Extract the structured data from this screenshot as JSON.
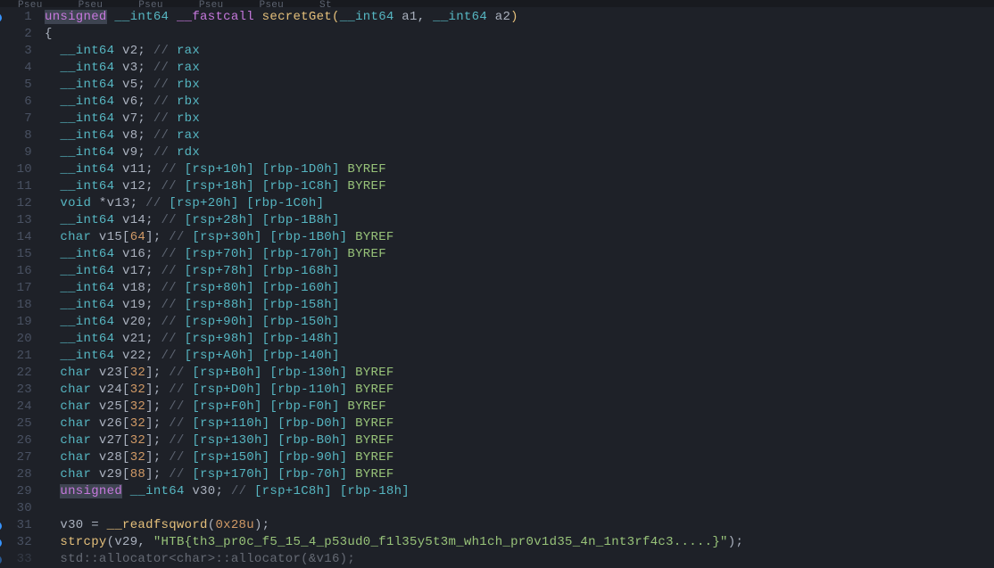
{
  "tabs": [
    "Pseu",
    "Pseu",
    "Pseu",
    "Pseu",
    "Pseu",
    "St"
  ],
  "lines": [
    {
      "n": 1,
      "bp": true,
      "tokens": [
        {
          "c": "kw-mod hl-bg",
          "t": "unsigned"
        },
        {
          "c": "op",
          "t": " "
        },
        {
          "c": "kw-type",
          "t": "__int64"
        },
        {
          "c": "op",
          "t": " "
        },
        {
          "c": "kw-mod",
          "t": "__fastcall"
        },
        {
          "c": "op",
          "t": " "
        },
        {
          "c": "kw-func",
          "t": "secretGet"
        },
        {
          "c": "paren-open",
          "t": "("
        },
        {
          "c": "kw-type",
          "t": "__int64"
        },
        {
          "c": "op",
          "t": " a1, "
        },
        {
          "c": "kw-type",
          "t": "__int64"
        },
        {
          "c": "op",
          "t": " a2"
        },
        {
          "c": "paren-close",
          "t": ")"
        }
      ]
    },
    {
      "n": 2,
      "bp": false,
      "tokens": [
        {
          "c": "brace",
          "t": "{"
        }
      ]
    },
    {
      "n": 3,
      "bp": false,
      "tokens": [
        {
          "c": "op",
          "t": "  "
        },
        {
          "c": "kw-type",
          "t": "__int64"
        },
        {
          "c": "op",
          "t": " v2; "
        },
        {
          "c": "comment",
          "t": "// "
        },
        {
          "c": "comment-str",
          "t": "rax"
        }
      ]
    },
    {
      "n": 4,
      "bp": false,
      "tokens": [
        {
          "c": "op",
          "t": "  "
        },
        {
          "c": "kw-type",
          "t": "__int64"
        },
        {
          "c": "op",
          "t": " v3; "
        },
        {
          "c": "comment",
          "t": "// "
        },
        {
          "c": "comment-str",
          "t": "rax"
        }
      ]
    },
    {
      "n": 5,
      "bp": false,
      "tokens": [
        {
          "c": "op",
          "t": "  "
        },
        {
          "c": "kw-type",
          "t": "__int64"
        },
        {
          "c": "op",
          "t": " v5; "
        },
        {
          "c": "comment",
          "t": "// "
        },
        {
          "c": "comment-str",
          "t": "rbx"
        }
      ]
    },
    {
      "n": 6,
      "bp": false,
      "tokens": [
        {
          "c": "op",
          "t": "  "
        },
        {
          "c": "kw-type",
          "t": "__int64"
        },
        {
          "c": "op",
          "t": " v6; "
        },
        {
          "c": "comment",
          "t": "// "
        },
        {
          "c": "comment-str",
          "t": "rbx"
        }
      ]
    },
    {
      "n": 7,
      "bp": false,
      "tokens": [
        {
          "c": "op",
          "t": "  "
        },
        {
          "c": "kw-type",
          "t": "__int64"
        },
        {
          "c": "op",
          "t": " v7; "
        },
        {
          "c": "comment",
          "t": "// "
        },
        {
          "c": "comment-str",
          "t": "rbx"
        }
      ]
    },
    {
      "n": 8,
      "bp": false,
      "tokens": [
        {
          "c": "op",
          "t": "  "
        },
        {
          "c": "kw-type",
          "t": "__int64"
        },
        {
          "c": "op",
          "t": " v8; "
        },
        {
          "c": "comment",
          "t": "// "
        },
        {
          "c": "comment-str",
          "t": "rax"
        }
      ]
    },
    {
      "n": 9,
      "bp": false,
      "tokens": [
        {
          "c": "op",
          "t": "  "
        },
        {
          "c": "kw-type",
          "t": "__int64"
        },
        {
          "c": "op",
          "t": " v9; "
        },
        {
          "c": "comment",
          "t": "// "
        },
        {
          "c": "comment-str",
          "t": "rdx"
        }
      ]
    },
    {
      "n": 10,
      "bp": false,
      "tokens": [
        {
          "c": "op",
          "t": "  "
        },
        {
          "c": "kw-type",
          "t": "__int64"
        },
        {
          "c": "op",
          "t": " v11; "
        },
        {
          "c": "comment",
          "t": "// "
        },
        {
          "c": "comment-str",
          "t": "[rsp+10h] [rbp-1D0h]"
        },
        {
          "c": "op",
          "t": " "
        },
        {
          "c": "comment-kw",
          "t": "BYREF"
        }
      ]
    },
    {
      "n": 11,
      "bp": false,
      "tokens": [
        {
          "c": "op",
          "t": "  "
        },
        {
          "c": "kw-type",
          "t": "__int64"
        },
        {
          "c": "op",
          "t": " v12; "
        },
        {
          "c": "comment",
          "t": "// "
        },
        {
          "c": "comment-str",
          "t": "[rsp+18h] [rbp-1C8h]"
        },
        {
          "c": "op",
          "t": " "
        },
        {
          "c": "comment-kw",
          "t": "BYREF"
        }
      ]
    },
    {
      "n": 12,
      "bp": false,
      "tokens": [
        {
          "c": "op",
          "t": "  "
        },
        {
          "c": "kw-type",
          "t": "void"
        },
        {
          "c": "op",
          "t": " *v13; "
        },
        {
          "c": "comment",
          "t": "// "
        },
        {
          "c": "comment-str",
          "t": "[rsp+20h] [rbp-1C0h]"
        }
      ]
    },
    {
      "n": 13,
      "bp": false,
      "tokens": [
        {
          "c": "op",
          "t": "  "
        },
        {
          "c": "kw-type",
          "t": "__int64"
        },
        {
          "c": "op",
          "t": " v14; "
        },
        {
          "c": "comment",
          "t": "// "
        },
        {
          "c": "comment-str",
          "t": "[rsp+28h] [rbp-1B8h]"
        }
      ]
    },
    {
      "n": 14,
      "bp": false,
      "tokens": [
        {
          "c": "op",
          "t": "  "
        },
        {
          "c": "kw-type",
          "t": "char"
        },
        {
          "c": "op",
          "t": " v15["
        },
        {
          "c": "num",
          "t": "64"
        },
        {
          "c": "op",
          "t": "]; "
        },
        {
          "c": "comment",
          "t": "// "
        },
        {
          "c": "comment-str",
          "t": "[rsp+30h] [rbp-1B0h]"
        },
        {
          "c": "op",
          "t": " "
        },
        {
          "c": "comment-kw",
          "t": "BYREF"
        }
      ]
    },
    {
      "n": 15,
      "bp": false,
      "tokens": [
        {
          "c": "op",
          "t": "  "
        },
        {
          "c": "kw-type",
          "t": "__int64"
        },
        {
          "c": "op",
          "t": " v16; "
        },
        {
          "c": "comment",
          "t": "// "
        },
        {
          "c": "comment-str",
          "t": "[rsp+70h] [rbp-170h]"
        },
        {
          "c": "op",
          "t": " "
        },
        {
          "c": "comment-kw",
          "t": "BYREF"
        }
      ]
    },
    {
      "n": 16,
      "bp": false,
      "tokens": [
        {
          "c": "op",
          "t": "  "
        },
        {
          "c": "kw-type",
          "t": "__int64"
        },
        {
          "c": "op",
          "t": " v17; "
        },
        {
          "c": "comment",
          "t": "// "
        },
        {
          "c": "comment-str",
          "t": "[rsp+78h] [rbp-168h]"
        }
      ]
    },
    {
      "n": 17,
      "bp": false,
      "tokens": [
        {
          "c": "op",
          "t": "  "
        },
        {
          "c": "kw-type",
          "t": "__int64"
        },
        {
          "c": "op",
          "t": " v18; "
        },
        {
          "c": "comment",
          "t": "// "
        },
        {
          "c": "comment-str",
          "t": "[rsp+80h] [rbp-160h]"
        }
      ]
    },
    {
      "n": 18,
      "bp": false,
      "tokens": [
        {
          "c": "op",
          "t": "  "
        },
        {
          "c": "kw-type",
          "t": "__int64"
        },
        {
          "c": "op",
          "t": " v19; "
        },
        {
          "c": "comment",
          "t": "// "
        },
        {
          "c": "comment-str",
          "t": "[rsp+88h] [rbp-158h]"
        }
      ]
    },
    {
      "n": 19,
      "bp": false,
      "tokens": [
        {
          "c": "op",
          "t": "  "
        },
        {
          "c": "kw-type",
          "t": "__int64"
        },
        {
          "c": "op",
          "t": " v20; "
        },
        {
          "c": "comment",
          "t": "// "
        },
        {
          "c": "comment-str",
          "t": "[rsp+90h] [rbp-150h]"
        }
      ]
    },
    {
      "n": 20,
      "bp": false,
      "tokens": [
        {
          "c": "op",
          "t": "  "
        },
        {
          "c": "kw-type",
          "t": "__int64"
        },
        {
          "c": "op",
          "t": " v21; "
        },
        {
          "c": "comment",
          "t": "// "
        },
        {
          "c": "comment-str",
          "t": "[rsp+98h] [rbp-148h]"
        }
      ]
    },
    {
      "n": 21,
      "bp": false,
      "tokens": [
        {
          "c": "op",
          "t": "  "
        },
        {
          "c": "kw-type",
          "t": "__int64"
        },
        {
          "c": "op",
          "t": " v22; "
        },
        {
          "c": "comment",
          "t": "// "
        },
        {
          "c": "comment-str",
          "t": "[rsp+A0h] [rbp-140h]"
        }
      ]
    },
    {
      "n": 22,
      "bp": false,
      "tokens": [
        {
          "c": "op",
          "t": "  "
        },
        {
          "c": "kw-type",
          "t": "char"
        },
        {
          "c": "op",
          "t": " v23["
        },
        {
          "c": "num",
          "t": "32"
        },
        {
          "c": "op",
          "t": "]; "
        },
        {
          "c": "comment",
          "t": "// "
        },
        {
          "c": "comment-str",
          "t": "[rsp+B0h] [rbp-130h]"
        },
        {
          "c": "op",
          "t": " "
        },
        {
          "c": "comment-kw",
          "t": "BYREF"
        }
      ]
    },
    {
      "n": 23,
      "bp": false,
      "tokens": [
        {
          "c": "op",
          "t": "  "
        },
        {
          "c": "kw-type",
          "t": "char"
        },
        {
          "c": "op",
          "t": " v24["
        },
        {
          "c": "num",
          "t": "32"
        },
        {
          "c": "op",
          "t": "]; "
        },
        {
          "c": "comment",
          "t": "// "
        },
        {
          "c": "comment-str",
          "t": "[rsp+D0h] [rbp-110h]"
        },
        {
          "c": "op",
          "t": " "
        },
        {
          "c": "comment-kw",
          "t": "BYREF"
        }
      ]
    },
    {
      "n": 24,
      "bp": false,
      "tokens": [
        {
          "c": "op",
          "t": "  "
        },
        {
          "c": "kw-type",
          "t": "char"
        },
        {
          "c": "op",
          "t": " v25["
        },
        {
          "c": "num",
          "t": "32"
        },
        {
          "c": "op",
          "t": "]; "
        },
        {
          "c": "comment",
          "t": "// "
        },
        {
          "c": "comment-str",
          "t": "[rsp+F0h] [rbp-F0h]"
        },
        {
          "c": "op",
          "t": " "
        },
        {
          "c": "comment-kw",
          "t": "BYREF"
        }
      ]
    },
    {
      "n": 25,
      "bp": false,
      "tokens": [
        {
          "c": "op",
          "t": "  "
        },
        {
          "c": "kw-type",
          "t": "char"
        },
        {
          "c": "op",
          "t": " v26["
        },
        {
          "c": "num",
          "t": "32"
        },
        {
          "c": "op",
          "t": "]; "
        },
        {
          "c": "comment",
          "t": "// "
        },
        {
          "c": "comment-str",
          "t": "[rsp+110h] [rbp-D0h]"
        },
        {
          "c": "op",
          "t": " "
        },
        {
          "c": "comment-kw",
          "t": "BYREF"
        }
      ]
    },
    {
      "n": 26,
      "bp": false,
      "tokens": [
        {
          "c": "op",
          "t": "  "
        },
        {
          "c": "kw-type",
          "t": "char"
        },
        {
          "c": "op",
          "t": " v27["
        },
        {
          "c": "num",
          "t": "32"
        },
        {
          "c": "op",
          "t": "]; "
        },
        {
          "c": "comment",
          "t": "// "
        },
        {
          "c": "comment-str",
          "t": "[rsp+130h] [rbp-B0h]"
        },
        {
          "c": "op",
          "t": " "
        },
        {
          "c": "comment-kw",
          "t": "BYREF"
        }
      ]
    },
    {
      "n": 27,
      "bp": false,
      "tokens": [
        {
          "c": "op",
          "t": "  "
        },
        {
          "c": "kw-type",
          "t": "char"
        },
        {
          "c": "op",
          "t": " v28["
        },
        {
          "c": "num",
          "t": "32"
        },
        {
          "c": "op",
          "t": "]; "
        },
        {
          "c": "comment",
          "t": "// "
        },
        {
          "c": "comment-str",
          "t": "[rsp+150h] [rbp-90h]"
        },
        {
          "c": "op",
          "t": " "
        },
        {
          "c": "comment-kw",
          "t": "BYREF"
        }
      ]
    },
    {
      "n": 28,
      "bp": false,
      "tokens": [
        {
          "c": "op",
          "t": "  "
        },
        {
          "c": "kw-type",
          "t": "char"
        },
        {
          "c": "op",
          "t": " v29["
        },
        {
          "c": "num",
          "t": "88"
        },
        {
          "c": "op",
          "t": "]; "
        },
        {
          "c": "comment",
          "t": "// "
        },
        {
          "c": "comment-str",
          "t": "[rsp+170h] [rbp-70h]"
        },
        {
          "c": "op",
          "t": " "
        },
        {
          "c": "comment-kw",
          "t": "BYREF"
        }
      ]
    },
    {
      "n": 29,
      "bp": false,
      "tokens": [
        {
          "c": "op",
          "t": "  "
        },
        {
          "c": "kw-mod hl-bg",
          "t": "unsigned"
        },
        {
          "c": "op",
          "t": " "
        },
        {
          "c": "kw-type",
          "t": "__int64"
        },
        {
          "c": "op",
          "t": " v30; "
        },
        {
          "c": "comment",
          "t": "// "
        },
        {
          "c": "comment-str",
          "t": "[rsp+1C8h] [rbp-18h]"
        }
      ]
    },
    {
      "n": 30,
      "bp": false,
      "tokens": [
        {
          "c": "op",
          "t": ""
        }
      ]
    },
    {
      "n": 31,
      "bp": true,
      "tokens": [
        {
          "c": "op",
          "t": "  v30 = "
        },
        {
          "c": "kw-func",
          "t": "__readfsqword"
        },
        {
          "c": "op",
          "t": "("
        },
        {
          "c": "num",
          "t": "0x28u"
        },
        {
          "c": "op",
          "t": ");"
        }
      ]
    },
    {
      "n": 32,
      "bp": true,
      "tokens": [
        {
          "c": "op",
          "t": "  "
        },
        {
          "c": "kw-func",
          "t": "strcpy"
        },
        {
          "c": "op",
          "t": "(v29, "
        },
        {
          "c": "str",
          "t": "\"HTB{th3_pr0c_f5_15_4_p53ud0_f1l35y5t3m_wh1ch_pr0v1d35_4n_1nt3rf4c3.....}\""
        },
        {
          "c": "op",
          "t": ");"
        }
      ]
    },
    {
      "n": 33,
      "bp": true,
      "tokens": [
        {
          "c": "op",
          "t": "  std::allocator<char>::allocator(&v16);"
        }
      ]
    }
  ]
}
